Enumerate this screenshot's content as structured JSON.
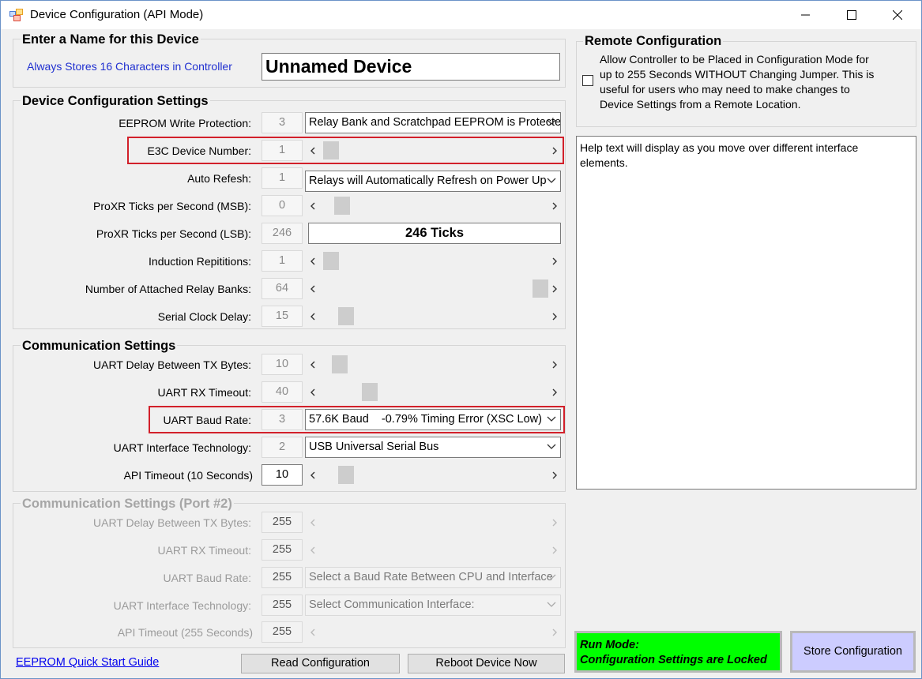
{
  "window": {
    "title": "Device Configuration (API Mode)"
  },
  "name_group": {
    "title": "Enter a Name for this Device",
    "hint": "Always Stores 16 Characters in Controller",
    "device_name": "Unnamed Device"
  },
  "device_group": {
    "title": "Device Configuration Settings",
    "rows": [
      {
        "label": "EEPROM Write Protection:",
        "value": "3",
        "combo": "Relay Bank and Scratchpad EEPROM is Protected"
      },
      {
        "label": "E3C Device Number:",
        "value": "1",
        "scroll": 0.02
      },
      {
        "label": "Auto Refesh:",
        "value": "1",
        "combo": "Relays will Automatically Refresh on Power Up"
      },
      {
        "label": "ProXR Ticks per Second (MSB):",
        "value": "0",
        "scroll": 0.07
      },
      {
        "label": "ProXR Ticks per Second (LSB):",
        "value": "246",
        "ticks": "246 Ticks"
      },
      {
        "label": "Induction Repititions:",
        "value": "1",
        "scroll": 0.02
      },
      {
        "label": "Number of Attached Relay Banks:",
        "value": "64",
        "scroll": 1.0
      },
      {
        "label": "Serial Clock Delay:",
        "value": "15",
        "scroll": 0.09
      }
    ]
  },
  "comm_group": {
    "title": "Communication Settings",
    "rows": [
      {
        "label": "UART Delay Between TX Bytes:",
        "value": "10",
        "scroll": 0.06
      },
      {
        "label": "UART RX Timeout:",
        "value": "40",
        "scroll": 0.2
      },
      {
        "label": "UART Baud Rate:",
        "value": "3",
        "combo": "57.6K Baud    -0.79% Timing Error (XSC Low)"
      },
      {
        "label": "UART Interface Technology:",
        "value": "2",
        "combo": "USB Universal Serial Bus"
      },
      {
        "label": "API Timeout (10 Seconds)",
        "value": "10",
        "scroll": 0.09
      }
    ]
  },
  "comm2_group": {
    "title": "Communication Settings (Port #2)",
    "rows": [
      {
        "label": "UART Delay Between TX Bytes:",
        "value": "255"
      },
      {
        "label": "UART RX Timeout:",
        "value": "255"
      },
      {
        "label": "UART Baud Rate:",
        "value": "255",
        "combo": "Select a Baud Rate Between CPU and Interface"
      },
      {
        "label": "UART Interface Technology:",
        "value": "255",
        "combo": "Select Communication Interface:"
      },
      {
        "label": "API Timeout (255 Seconds)",
        "value": "255"
      }
    ]
  },
  "remote_group": {
    "title": "Remote Configuration",
    "line1": "Allow Controller to be Placed in Configuration Mode for",
    "line2": "up to 255 Seconds WITHOUT Changing Jumper.  This is",
    "line3": "useful for users who may need to make changes to",
    "line4": "Device Settings from a Remote Location."
  },
  "help": {
    "line1": "Help text will display as you move over different interface",
    "line2": "elements."
  },
  "footer": {
    "quick_start_link": "EEPROM Quick Start Guide",
    "read_button": "Read Configuration",
    "reboot_button": "Reboot Device Now",
    "run_mode_line1": "Run Mode:",
    "run_mode_line2": "Configuration Settings are Locked",
    "store_button": "Store Configuration"
  },
  "colors": {
    "red_highlight": "#d2202a",
    "run_mode_bg": "#00ff00",
    "store_bg": "#ccccff",
    "link": "#0000ee"
  }
}
